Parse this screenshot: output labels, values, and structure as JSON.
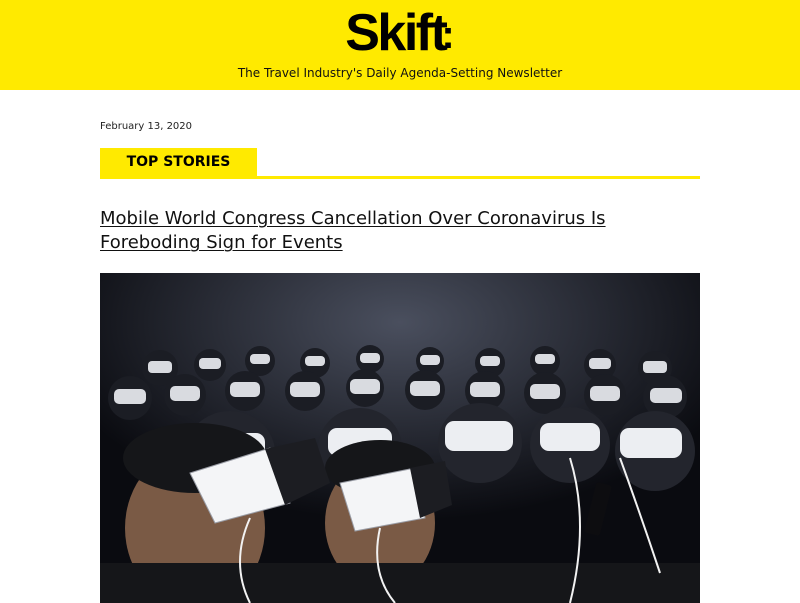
{
  "header": {
    "logo_text": "Skift",
    "logo_dot": ":",
    "tagline": "The Travel Industry's Daily Agenda-Setting Newsletter",
    "background_color": "#ffea00"
  },
  "main": {
    "date": "February 13, 2020",
    "section_label": "TOP STORIES",
    "headline": "Mobile World Congress Cancellation Over Coronavirus Is Foreboding Sign for Events",
    "hero_image": {
      "alt": "Audience wearing virtual reality headsets"
    }
  },
  "colors": {
    "accent": "#ffea00",
    "text": "#111111",
    "background": "#ffffff"
  }
}
